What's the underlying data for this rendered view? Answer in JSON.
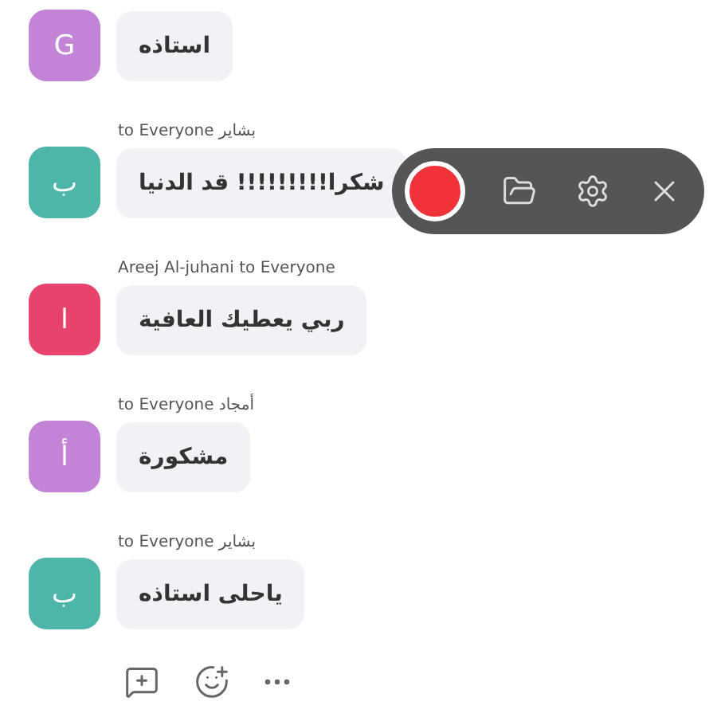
{
  "messages": [
    {
      "avatar": "G",
      "color": "#c384d8",
      "text": "استاذه"
    },
    {
      "header": "بشاير to Everyone",
      "avatar": "ب",
      "color": "#4db6a8",
      "text": "شكرا!!!!!!!!! قد الدنيا"
    },
    {
      "header": "Areej Al-juhani to Everyone",
      "avatar": "ا",
      "color": "#e8436c",
      "text": "ربي يعطيك العافية"
    },
    {
      "header": "أمجاد to Everyone",
      "avatar": "أ",
      "color": "#c384d8",
      "text": "مشكورة"
    },
    {
      "header": "بشاير to Everyone",
      "avatar": "ب",
      "color": "#4db6a8",
      "text": "ياحلى استاذه"
    }
  ]
}
